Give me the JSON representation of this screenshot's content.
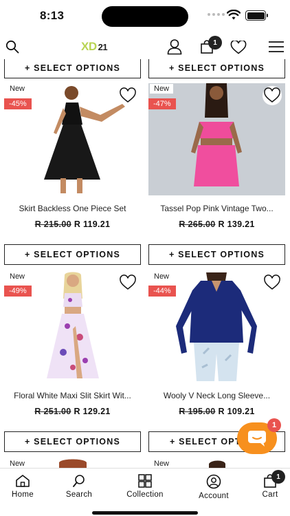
{
  "status_bar": {
    "time": "8:13"
  },
  "header": {
    "logo_main": "XD",
    "logo_num": "21",
    "cart_count": "1",
    "icons": [
      "search-icon",
      "user-icon",
      "bag-icon",
      "heart-icon",
      "menu-icon"
    ]
  },
  "button_label": "+ SELECT OPTIONS",
  "products": [
    {
      "badge_new": "New",
      "discount": "-45%",
      "title": "Skirt Backless One Piece Set",
      "old_price": "R 215.00",
      "price": "R 119.21"
    },
    {
      "badge_new": "New",
      "discount": "-47%",
      "title": "Tassel Pop Pink Vintage Two...",
      "old_price": "R 265.00",
      "price": "R 139.21"
    },
    {
      "badge_new": "New",
      "discount": "-49%",
      "title": "Floral White Maxi Slit Skirt Wit...",
      "old_price": "R 251.00",
      "price": "R 129.21"
    },
    {
      "badge_new": "New",
      "discount": "-44%",
      "title": "Wooly V Neck Long Sleeve...",
      "old_price": "R 195.00",
      "price": "R 109.21"
    },
    {
      "badge_new": "New"
    },
    {
      "badge_new": "New"
    }
  ],
  "top_buttons": [
    "+ SELECT OPTIONS",
    "+ SELECT OPTIONS"
  ],
  "mid_buttons": [
    "+ SELECT OPTIONS",
    "+ SELECT OPTIONS"
  ],
  "bottom_buttons": [
    "+ SELECT OPTIONS",
    "+ SELECT OPT"
  ],
  "chat": {
    "badge": "1"
  },
  "tabbar": {
    "items": [
      {
        "label": "Home",
        "icon": "home-icon"
      },
      {
        "label": "Search",
        "icon": "search-icon"
      },
      {
        "label": "Collection",
        "icon": "grid-icon"
      },
      {
        "label": "Account",
        "icon": "account-icon"
      },
      {
        "label": "Cart",
        "icon": "cart-icon"
      }
    ],
    "cart_badge": "1"
  },
  "colors": {
    "logo_green": "#b8d454",
    "discount_red": "#e9534f",
    "chat_orange": "#f7901e"
  }
}
